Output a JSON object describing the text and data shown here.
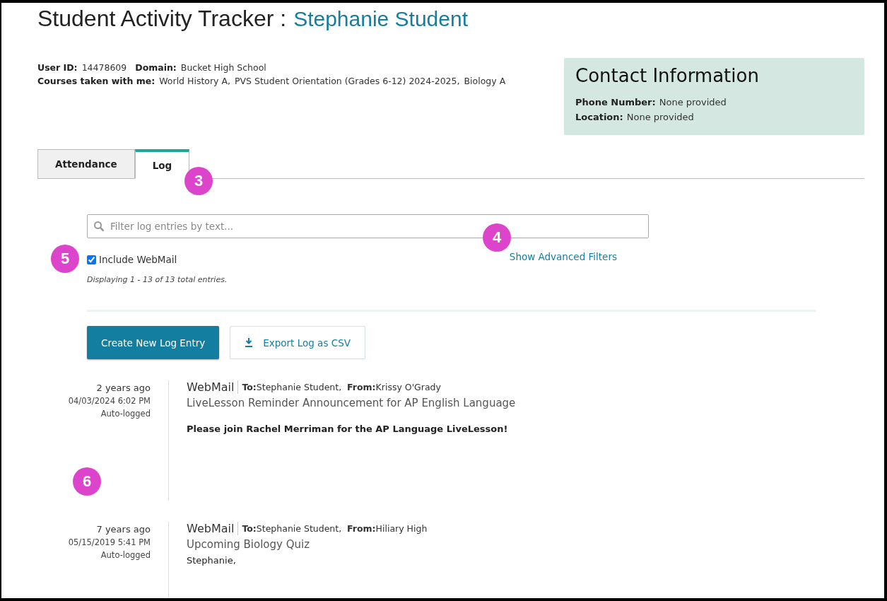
{
  "header": {
    "title": "Student Activity Tracker :",
    "student_name": "Stephanie Student"
  },
  "info": [
    {
      "label": "User ID:",
      "value": "14478609"
    },
    {
      "label": "Domain:",
      "value": "Bucket High School"
    }
  ],
  "courses": {
    "label": "Courses taken with me:",
    "values": [
      "World History A,",
      "PVS Student Orientation (Grades 6-12) 2024-2025,",
      "Biology A"
    ]
  },
  "contact": {
    "title": "Contact Information",
    "fields": [
      {
        "label": "Phone Number:",
        "value": "None provided"
      },
      {
        "label": "Location:",
        "value": "None provided"
      }
    ]
  },
  "tabs": [
    {
      "label": "Attendance",
      "selected": false
    },
    {
      "label": "Log",
      "selected": true
    }
  ],
  "filter": {
    "placeholder": "Filter log entries by text..."
  },
  "include_webmail": {
    "label": "Include WebMail",
    "checked": true
  },
  "advanced_filters": "Show Advanced Filters",
  "count": "Displaying 1 - 13 of 13 total entries.",
  "buttons": [
    {
      "label": "Create New Log Entry",
      "kind": "primary"
    },
    {
      "label": "Export Log as CSV",
      "kind": "export"
    }
  ],
  "entries": [
    {
      "age": "2 years ago",
      "datetime": "04/03/2024 6:02 PM",
      "source": "Auto-logged",
      "type": "WebMail",
      "to_label": "To:",
      "to": "Stephanie Student,",
      "from_label": "From:",
      "from": "Krissy O'Grady",
      "subject": "LiveLesson Reminder Announcement for AP English Language",
      "body": "Please join Rachel Merriman for the AP Language LiveLesson!",
      "body_bold": true
    },
    {
      "age": "7 years ago",
      "datetime": "05/15/2019 5:41 PM",
      "source": "Auto-logged",
      "type": "WebMail",
      "to_label": "To:",
      "to": "Stephanie Student,",
      "from_label": "From:",
      "from": "Hiliary High",
      "subject": "Upcoming Biology Quiz",
      "body": "Stephanie,",
      "body_bold": false
    }
  ],
  "callouts": [
    "3",
    "4",
    "5",
    "6"
  ]
}
